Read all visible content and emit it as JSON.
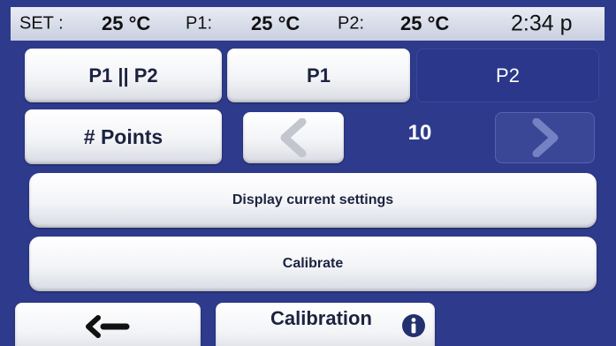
{
  "status_bar": {
    "set_label": "SET :",
    "set_value": "25 °C",
    "p1_label": "P1:",
    "p1_value": "25 °C",
    "p2_label": "P2:",
    "p2_value": "25 °C",
    "time": "2:34 p"
  },
  "tabs": [
    {
      "label": "P1 || P2",
      "selected": false
    },
    {
      "label": "P1",
      "selected": false
    },
    {
      "label": "P2",
      "selected": true
    }
  ],
  "points": {
    "label": "# Points",
    "value": "10",
    "prev_icon": "chevron-left-icon",
    "next_icon": "chevron-right-icon"
  },
  "actions": {
    "display_settings": "Display current settings",
    "calibrate": "Calibrate"
  },
  "footer": {
    "back_icon": "back-arrow-icon",
    "calibration_label": "Calibration",
    "info_icon": "info-icon"
  },
  "colors": {
    "background": "#2e3b8c",
    "selected_tab": "#2a378a",
    "button": "#f3f4f7",
    "status_bar": "#dfe3ee"
  }
}
